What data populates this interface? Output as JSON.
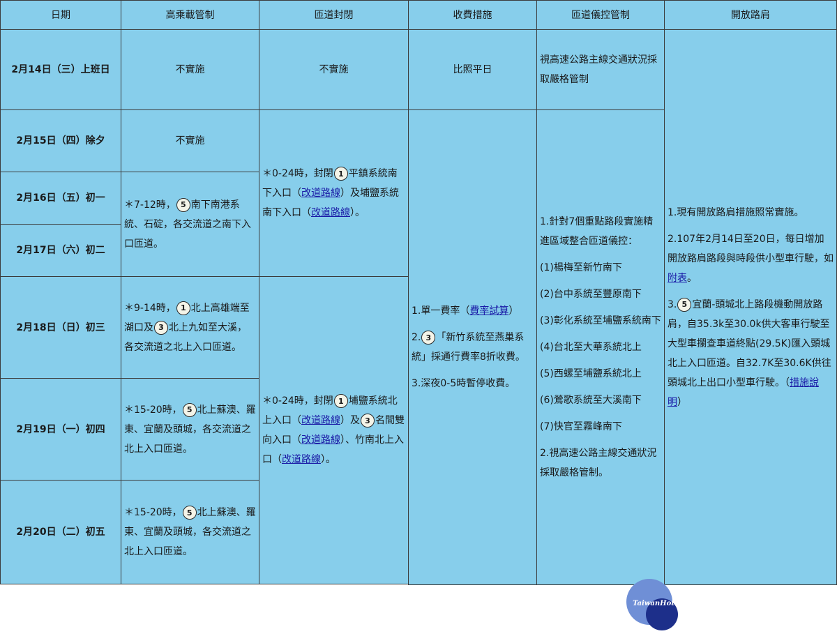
{
  "headers": [
    "日期",
    "高乘載管制",
    "匝道封閉",
    "收費措施",
    "匝道儀控管制",
    "開放路肩"
  ],
  "dates": [
    "2月14日（三）上班日",
    "2月15日（四）除夕",
    "2月16日（五）初一",
    "2月17日（六）初二",
    "2月18日（日）初三",
    "2月19日（一）初四",
    "2月20日（二）初五"
  ],
  "hov": {
    "r1": "不實施",
    "r2": "不實施",
    "r34": {
      "pre": "＊7-12時，",
      "badge": "5",
      "post": "南下南港系統、石碇，各交流道之南下入口匝道。"
    },
    "r5": {
      "pre": "＊9-14時，",
      "badge1": "1",
      "mid": "北上高雄端至湖口及",
      "badge2": "3",
      "post": "北上九如至大溪，各交流道之北上入口匝道。"
    },
    "r6": {
      "pre": "＊15-20時，",
      "badge": "5",
      "post": "北上蘇澳、羅東、宜蘭及頭城，各交流道之北上入口匝道。"
    },
    "r7": {
      "pre": "＊15-20時，",
      "badge": "5",
      "post": "北上蘇澳、羅東、宜蘭及頭城，各交流道之北上入口匝道。"
    }
  },
  "ramp": {
    "r1": "不實施",
    "r24": {
      "pre": "＊0-24時，封閉",
      "badge": "1",
      "mid": "平鎮系統南下入口（",
      "link1": "改道路線",
      "mid2": "）及埔鹽系統南下入口（",
      "link2": "改道路線",
      "post": "）。"
    },
    "r57": {
      "pre": "＊0-24時，封閉",
      "badge1": "1",
      "mid": "埔鹽系統北上入口（",
      "link1": "改道路線",
      "mid2": "）及",
      "badge2": "3",
      "mid3": "名間雙向入口（",
      "link2": "改道路線",
      "mid4": "）、竹南北上入口（",
      "link3": "改道路線",
      "post": "）。"
    }
  },
  "toll": {
    "r1": "比照平日",
    "p1_pre": "1.單一費率（",
    "p1_link": "費率試算",
    "p1_post": "）",
    "p2_pre": "2.",
    "p2_badge": "3",
    "p2_post": "「新竹系統至燕巢系統」採通行費率8折收費。",
    "p3": "3.深夜0-5時暫停收費。"
  },
  "meter": {
    "r1": "視高速公路主線交通狀況採取嚴格管制",
    "items": [
      "1.針對7個重點路段實施精進區域整合匝道儀控：",
      "(1)楊梅至新竹南下",
      "(2)台中系統至豐原南下",
      "(3)彰化系統至埔鹽系統南下",
      "(4)台北至大華系統北上",
      "(5)西螺至埔鹽系統北上",
      "(6)鶯歌系統至大溪南下",
      "(7)快官至霧峰南下",
      "2.視高速公路主線交通狀況採取嚴格管制。"
    ]
  },
  "shoulder": {
    "p1": "1.現有開放路肩措施照常實施。",
    "p2_pre": "2.107年2月14日至20日，每日增加開放路肩路段與時段供小型車行駛，如",
    "p2_link": "附表",
    "p2_post": "。",
    "p3_pre": "3.",
    "p3_badge": "5",
    "p3_mid": "宜蘭-頭城北上路段機動開放路肩，自35.3k至30.0k供大客車行駛至大型車攔查車道終點(29.5K)匯入頭城北上入口匝道。自32.7K至30.6K供往頭城北上出口小型車行駛。（",
    "p3_link": "措施說明",
    "p3_post": "）"
  },
  "logo_text": "TaiwanHot"
}
